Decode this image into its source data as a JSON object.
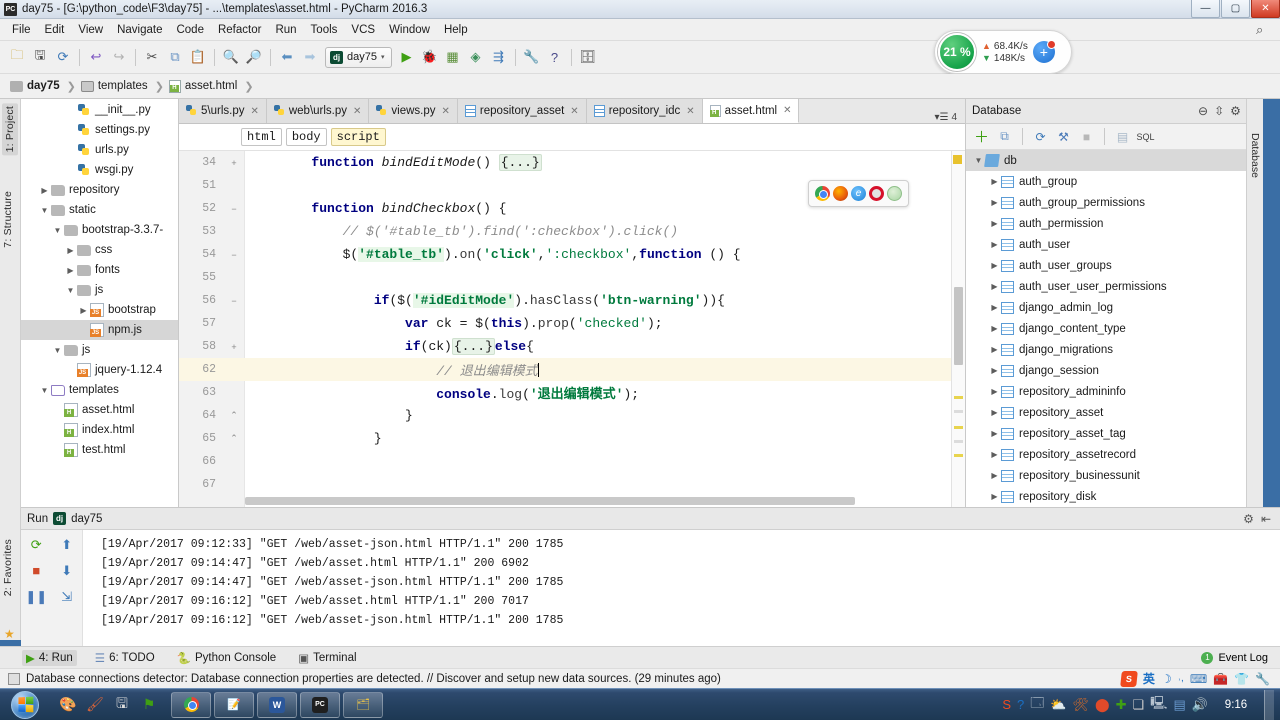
{
  "window": {
    "title": "day75 - [G:\\python_code\\F3\\day75] - ...\\templates\\asset.html - PyCharm 2016.3",
    "app_icon": "pycharm-icon",
    "minimize": "—",
    "maximize": "▢",
    "close": "✕"
  },
  "menu": {
    "items": [
      "File",
      "Edit",
      "View",
      "Navigate",
      "Code",
      "Refactor",
      "Run",
      "Tools",
      "VCS",
      "Window",
      "Help"
    ],
    "search_icon": "search-icon"
  },
  "toolbar": {
    "icons": [
      "open-folder-icon",
      "save-all-icon",
      "sync-icon",
      "undo-icon",
      "redo-icon",
      "cut-icon",
      "copy-icon",
      "paste-icon",
      "find-icon",
      "replace-icon",
      "back-icon",
      "forward-icon"
    ],
    "run_config": {
      "icon": "django-icon",
      "label": "day75",
      "caret": "▾"
    },
    "actions": [
      "run-icon",
      "debug-icon",
      "coverage-icon",
      "profile-icon",
      "run-with-console-icon",
      "settings-icon",
      "help-icon",
      "database-icon"
    ]
  },
  "net_widget": {
    "cpu_percent": "21 %",
    "upload": "68.4K/s",
    "download": "148K/s",
    "up_arrow": "▲",
    "down_arrow": "▼",
    "plus_icon": "add-icon"
  },
  "breadcrumb": {
    "items": [
      {
        "label": "day75",
        "icon": "folder-icon"
      },
      {
        "label": "templates",
        "icon": "folder-open-icon"
      },
      {
        "label": "asset.html",
        "icon": "html-file-icon"
      }
    ],
    "separator": "❯"
  },
  "left_strip": {
    "tabs": [
      {
        "label": "1: Project",
        "selected": true
      },
      {
        "label": "7: Structure",
        "selected": false
      },
      {
        "label": "2: Favorites",
        "selected": false
      }
    ]
  },
  "project_tree": {
    "rows": [
      {
        "label": "__init__.py",
        "indent": 3,
        "twisty": "",
        "icon": "python-file-icon",
        "selected": false
      },
      {
        "label": "settings.py",
        "indent": 3,
        "twisty": "",
        "icon": "python-file-icon",
        "selected": false
      },
      {
        "label": "urls.py",
        "indent": 3,
        "twisty": "",
        "icon": "python-file-icon",
        "selected": false
      },
      {
        "label": "wsgi.py",
        "indent": 3,
        "twisty": "",
        "icon": "python-file-icon",
        "selected": false
      },
      {
        "label": "repository",
        "indent": 1,
        "twisty": "▶",
        "icon": "folder-icon",
        "selected": false
      },
      {
        "label": "static",
        "indent": 1,
        "twisty": "▼",
        "icon": "folder-icon",
        "selected": false
      },
      {
        "label": "bootstrap-3.3.7-",
        "indent": 2,
        "twisty": "▼",
        "icon": "folder-icon",
        "selected": false
      },
      {
        "label": "css",
        "indent": 3,
        "twisty": "▶",
        "icon": "folder-icon",
        "selected": false
      },
      {
        "label": "fonts",
        "indent": 3,
        "twisty": "▶",
        "icon": "folder-icon",
        "selected": false
      },
      {
        "label": "js",
        "indent": 3,
        "twisty": "▼",
        "icon": "folder-icon",
        "selected": false
      },
      {
        "label": "bootstrap",
        "indent": 4,
        "twisty": "▶",
        "icon": "js-file-icon",
        "selected": false
      },
      {
        "label": "npm.js",
        "indent": 4,
        "twisty": "",
        "icon": "js-file-icon",
        "selected": true
      },
      {
        "label": "js",
        "indent": 2,
        "twisty": "▼",
        "icon": "folder-icon",
        "selected": false
      },
      {
        "label": "jquery-1.12.4",
        "indent": 3,
        "twisty": "",
        "icon": "js-file-icon",
        "selected": false
      },
      {
        "label": "templates",
        "indent": 1,
        "twisty": "▼",
        "icon": "folder-templates-icon",
        "selected": false
      },
      {
        "label": "asset.html",
        "indent": 2,
        "twisty": "",
        "icon": "html-file-icon",
        "selected": false
      },
      {
        "label": "index.html",
        "indent": 2,
        "twisty": "",
        "icon": "html-file-icon",
        "selected": false
      },
      {
        "label": "test.html",
        "indent": 2,
        "twisty": "",
        "icon": "html-file-icon",
        "selected": false
      }
    ]
  },
  "editor": {
    "tabs": [
      {
        "label": "5\\urls.py",
        "icon": "python-file-icon",
        "active": false,
        "close": "✕"
      },
      {
        "label": "web\\urls.py",
        "icon": "python-file-icon",
        "active": false,
        "close": "✕"
      },
      {
        "label": "views.py",
        "icon": "python-file-icon",
        "active": false,
        "close": "✕"
      },
      {
        "label": "repository_asset",
        "icon": "table-icon",
        "active": false,
        "close": "✕"
      },
      {
        "label": "repository_idc",
        "icon": "table-icon",
        "active": false,
        "close": "✕"
      },
      {
        "label": "asset.html",
        "icon": "html-file-icon",
        "active": true,
        "close": "✕"
      }
    ],
    "tab_overflow": "4",
    "structure_crumbs": [
      {
        "label": "html",
        "highlighted": false
      },
      {
        "label": "body",
        "highlighted": false
      },
      {
        "label": "script",
        "highlighted": true
      }
    ],
    "lines": [
      {
        "num": "34",
        "fold": "+",
        "current": false,
        "html": "        <span class='kw'>function</span> <span class='fn'>bindEditMode</span>() <span class='fold-box'>{...}</span>"
      },
      {
        "num": "51",
        "fold": "",
        "current": false,
        "html": ""
      },
      {
        "num": "52",
        "fold": "−",
        "current": false,
        "html": "        <span class='kw'>function</span> <span class='fn'>bindCheckbox</span>() {"
      },
      {
        "num": "53",
        "fold": "",
        "current": false,
        "html": "            <span class='cm'>// $('#table_tb').find(':checkbox').click()</span>"
      },
      {
        "num": "54",
        "fold": "−",
        "current": false,
        "html": "            $(<span class='str hl-str'>'#table_tb'</span>).<span class='mtd'>on</span>(<span class='str'>'click'</span>,<span class='strq'>':checkbox'</span>,<span class='kw'>function</span> () {"
      },
      {
        "num": "55",
        "fold": "",
        "current": false,
        "html": ""
      },
      {
        "num": "56",
        "fold": "−",
        "current": false,
        "html": "                <span class='kw'>if</span>($(<span class='str hl-str'>'#idEditMode'</span>).<span class='mtd'>hasClass</span>(<span class='str'>'btn-warning'</span>)){"
      },
      {
        "num": "57",
        "fold": "",
        "current": false,
        "html": "                    <span class='kw'>var</span> ck = $(<span class='kw'>this</span>).<span class='mtd'>prop</span>(<span class='strq'>'checked'</span>);"
      },
      {
        "num": "58",
        "fold": "+",
        "current": false,
        "html": "                    <span class='kw'>if</span>(ck)<span class='fold-box'>{...}</span><span class='kw'>else</span>{"
      },
      {
        "num": "62",
        "fold": "",
        "current": true,
        "html": "                        <span class='cm'>// 退出编辑模式</span><span class='caret-bar'></span>"
      },
      {
        "num": "63",
        "fold": "",
        "current": false,
        "html": "                        <span class='kw'>console</span>.<span class='mtd'>log</span>(<span class='str'>'退出编辑模式'</span>);"
      },
      {
        "num": "64",
        "fold": "⌃",
        "current": false,
        "html": "                    }"
      },
      {
        "num": "65",
        "fold": "⌃",
        "current": false,
        "html": "                }"
      },
      {
        "num": "66",
        "fold": "",
        "current": false,
        "html": ""
      },
      {
        "num": "67",
        "fold": "",
        "current": false,
        "html": ""
      }
    ],
    "browser_popup": [
      "chrome-icon",
      "firefox-icon",
      "ie-icon",
      "opera-icon",
      "js-debug-icon"
    ]
  },
  "database": {
    "title": "Database",
    "header_icons": [
      "collapse-all-icon",
      "expand-all-icon",
      "gear-icon",
      "hide-icon"
    ],
    "toolbar_icons": [
      "add-icon",
      "duplicate-icon",
      "refresh-icon",
      "sync-schema-icon",
      "stop-icon",
      "table-view-icon",
      "sql-console-icon"
    ],
    "vertical_tab": "Database",
    "root": {
      "label": "db",
      "twisty": "▼",
      "icon": "database-icon"
    },
    "tables": [
      "auth_group",
      "auth_group_permissions",
      "auth_permission",
      "auth_user",
      "auth_user_groups",
      "auth_user_user_permissions",
      "django_admin_log",
      "django_content_type",
      "django_migrations",
      "django_session",
      "repository_admininfo",
      "repository_asset",
      "repository_asset_tag",
      "repository_assetrecord",
      "repository_businessunit",
      "repository_disk"
    ],
    "table_twisty": "▶"
  },
  "run_console": {
    "tab_label": "Run",
    "config_icon": "django-icon",
    "config_name": "day75",
    "header_right_icons": [
      "gear-icon",
      "hide-icon"
    ],
    "side_icons": [
      "rerun-icon",
      "stop-icon",
      "pause-icon",
      "scroll-up-icon",
      "scroll-down-icon",
      "soft-wrap-icon"
    ],
    "lines": [
      "[19/Apr/2017 09:12:33] \"GET /web/asset-json.html HTTP/1.1\" 200 1785",
      "[19/Apr/2017 09:14:47] \"GET /web/asset.html HTTP/1.1\" 200 6902",
      "[19/Apr/2017 09:14:47] \"GET /web/asset-json.html HTTP/1.1\" 200 1785",
      "[19/Apr/2017 09:16:12] \"GET /web/asset.html HTTP/1.1\" 200 7017",
      "[19/Apr/2017 09:16:12] \"GET /web/asset-json.html HTTP/1.1\" 200 1785"
    ]
  },
  "bottom_strip": {
    "tabs": [
      {
        "label": "4: Run",
        "icon": "run-icon",
        "selected": true
      },
      {
        "label": "6: TODO",
        "icon": "todo-icon",
        "selected": false
      },
      {
        "label": "Python Console",
        "icon": "python-icon",
        "selected": false
      },
      {
        "label": "Terminal",
        "icon": "terminal-icon",
        "selected": false
      }
    ],
    "event_log": {
      "label": "Event Log",
      "count": "1"
    }
  },
  "status_bar": {
    "icon": "notification-icon",
    "message": "Database connections detector: Database connection properties are detected. // Discover and setup new data sources. (29 minutes ago)",
    "tray_icons": [
      "sogou-icon",
      "ime-chinese-icon",
      "moon-icon",
      "punctuation-icon",
      "keyboard-icon",
      "toolbox-icon",
      "skin-icon",
      "wrench-icon"
    ]
  },
  "taskbar": {
    "start_label": "start-orb",
    "quicklaunch": [
      "paint-icon",
      "media-icon",
      "save-icon",
      "flag-icon"
    ],
    "buttons": [
      "chrome-icon",
      "notepad-icon",
      "word-icon",
      "pycharm-icon",
      "explorer-icon"
    ],
    "tray": [
      "sogou-icon",
      "help-icon",
      "network-panel-icon",
      "weather-icon",
      "tools-icon",
      "record-icon",
      "security-icon",
      "windows-icon",
      "monitor-icon",
      "app-icon",
      "volume-icon"
    ],
    "clock": "9:16"
  }
}
